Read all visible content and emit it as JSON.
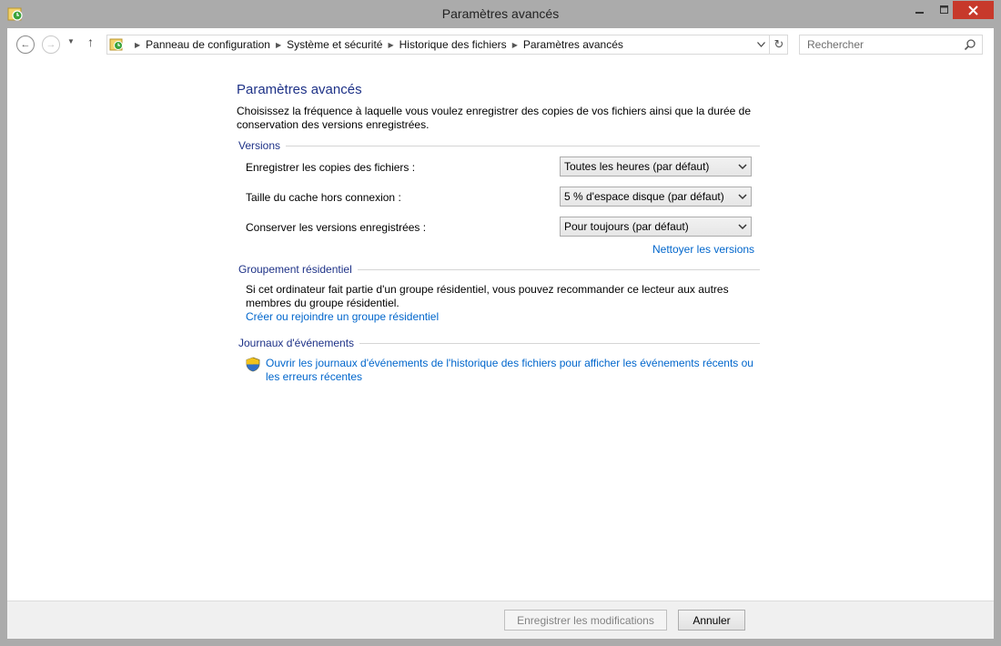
{
  "window": {
    "title": "Paramètres avancés"
  },
  "nav": {
    "breadcrumbs": [
      "Panneau de configuration",
      "Système et sécurité",
      "Historique des fichiers",
      "Paramètres avancés"
    ],
    "search_placeholder": "Rechercher"
  },
  "page": {
    "title": "Paramètres avancés",
    "intro": "Choisissez la fréquence à laquelle vous voulez enregistrer des copies de vos fichiers ainsi que la durée de conservation des versions enregistrées.",
    "versions": {
      "heading": "Versions",
      "rows": [
        {
          "label": "Enregistrer les copies des fichiers :",
          "value": "Toutes les heures (par défaut)"
        },
        {
          "label": "Taille du cache hors connexion :",
          "value": "5 % d'espace disque (par défaut)"
        },
        {
          "label": "Conserver les versions enregistrées :",
          "value": "Pour toujours (par défaut)"
        }
      ],
      "cleanup_link": "Nettoyer les versions"
    },
    "homegroup": {
      "heading": "Groupement résidentiel",
      "text": "Si cet ordinateur fait partie d'un groupe résidentiel, vous pouvez recommander ce lecteur aux autres membres du groupe résidentiel.",
      "link": "Créer ou rejoindre un groupe résidentiel"
    },
    "events": {
      "heading": "Journaux d'événements",
      "link_line1": "Ouvrir les journaux d'événements de l'historique des fichiers pour afficher les événements récents ou",
      "link_line2": "les erreurs récentes"
    }
  },
  "footer": {
    "save_label": "Enregistrer les modifications",
    "cancel_label": "Annuler"
  },
  "colors": {
    "heading_blue": "#1e3287",
    "link_blue": "#0066cc",
    "close_red": "#c7392b"
  }
}
